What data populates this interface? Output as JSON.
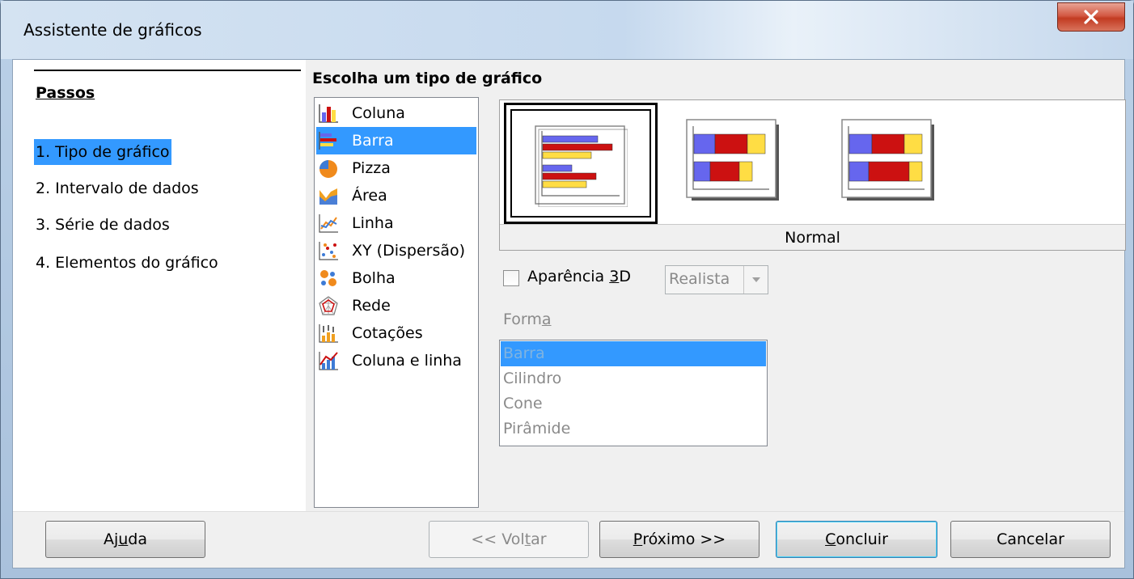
{
  "window": {
    "title": "Assistente de gráficos",
    "close_label": "x"
  },
  "steps": {
    "title": "Passos",
    "items": [
      {
        "label": "1. Tipo de gráfico",
        "active": true
      },
      {
        "label": "2. Intervalo de dados",
        "active": false
      },
      {
        "label": "3. Série de dados",
        "active": false
      },
      {
        "label": "4. Elementos do gráfico",
        "active": false
      }
    ]
  },
  "main": {
    "heading": "Escolha um tipo de gráfico",
    "chart_types": [
      {
        "label": "Coluna",
        "icon": "column-chart-icon"
      },
      {
        "label": "Barra",
        "icon": "bar-chart-icon",
        "selected": true
      },
      {
        "label": "Pizza",
        "icon": "pie-chart-icon"
      },
      {
        "label": "Área",
        "icon": "area-chart-icon"
      },
      {
        "label": "Linha",
        "icon": "line-chart-icon"
      },
      {
        "label": "XY (Dispersão)",
        "icon": "scatter-chart-icon"
      },
      {
        "label": "Bolha",
        "icon": "bubble-chart-icon"
      },
      {
        "label": "Rede",
        "icon": "net-chart-icon"
      },
      {
        "label": "Cotações",
        "icon": "stock-chart-icon"
      },
      {
        "label": "Coluna e linha",
        "icon": "column-line-chart-icon"
      }
    ],
    "variant_label": "Normal",
    "appearance_3d": {
      "label_before": "Aparência ",
      "label_mnemonic": "3",
      "label_after": "D",
      "checked": false
    },
    "appearance_combo": {
      "value": "Realista"
    },
    "shape": {
      "label_before": "Form",
      "label_mnemonic": "a",
      "items": [
        "Barra",
        "Cilindro",
        "Cone",
        "Pirâmide"
      ],
      "selected": "Barra"
    }
  },
  "buttons": {
    "help": {
      "before": "Aj",
      "mnemonic": "u",
      "after": "da"
    },
    "back": {
      "before": "<< Vol",
      "mnemonic": "t",
      "after": "ar"
    },
    "next": {
      "before": "",
      "mnemonic": "P",
      "after": "róximo >>"
    },
    "finish": {
      "before": "",
      "mnemonic": "C",
      "after": "oncluir"
    },
    "cancel": {
      "label": "Cancelar"
    }
  },
  "colors": {
    "selection": "#3399ff",
    "bar_blue": "#6666ee",
    "bar_red": "#cc1111",
    "bar_yellow": "#ffdd44"
  }
}
